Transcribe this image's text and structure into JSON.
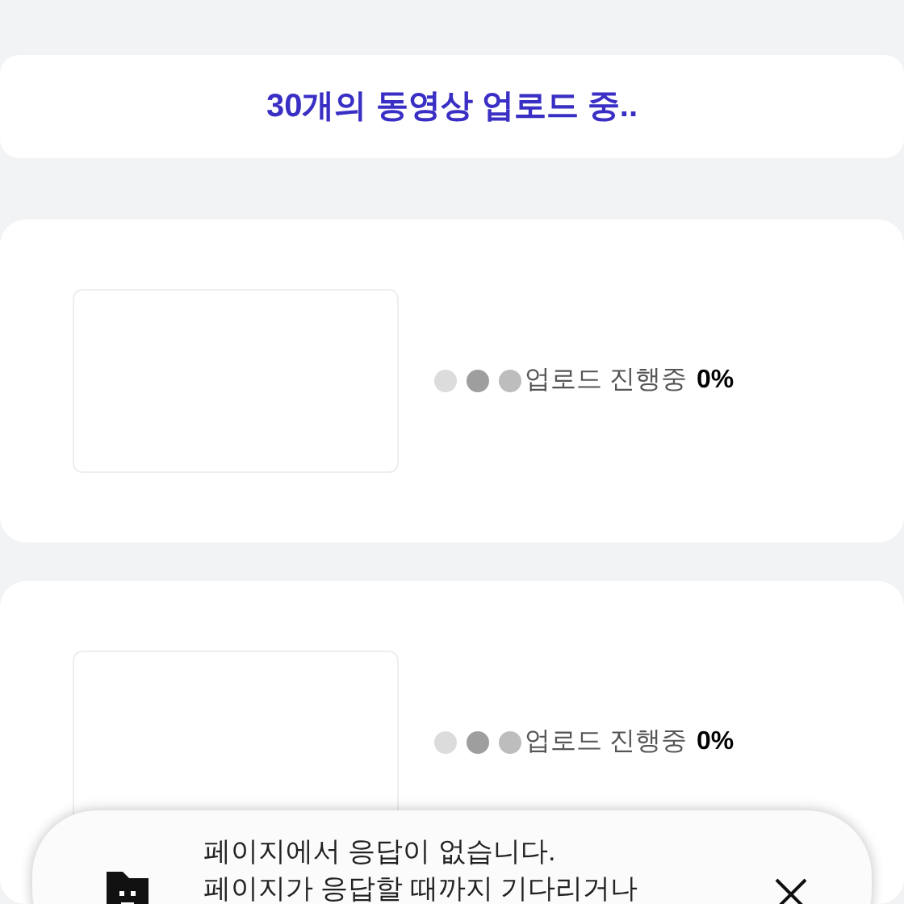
{
  "header": {
    "title": "30개의 동영상 업로드 중.."
  },
  "uploads": [
    {
      "dots": [
        {
          "color": "#dcdcdc"
        },
        {
          "color": "#9e9e9e"
        },
        {
          "color": "#bdbdbd"
        }
      ],
      "status": "업로드 진행중",
      "percent": "0%"
    },
    {
      "dots": [
        {
          "color": "#dcdcdc"
        },
        {
          "color": "#9e9e9e"
        },
        {
          "color": "#bdbdbd"
        }
      ],
      "status": "업로드 진행중",
      "percent": "0%"
    }
  ],
  "toast": {
    "lines": [
      "페이지에서 응답이 없습니다.",
      "페이지가 응답할 때까지 기다리거나"
    ]
  }
}
